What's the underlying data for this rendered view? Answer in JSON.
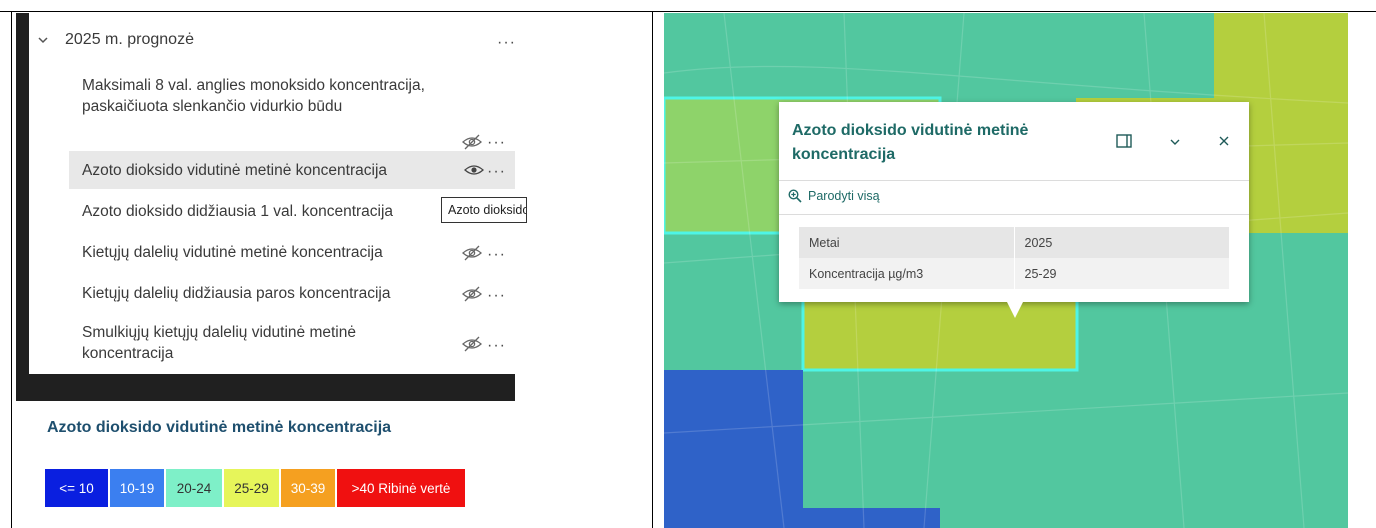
{
  "layer_panel": {
    "group_label": "2025 m. prognozė",
    "layers": [
      {
        "label": "Maksimali 8 val. anglies monoksido koncentracija, paskaičiuota slenkančio vidurkio būdu",
        "visible": false
      },
      {
        "label": "Azoto dioksido vidutinė metinė koncentracija",
        "visible": true,
        "selected": true
      },
      {
        "label": "Azoto dioksido didžiausia 1 val. koncentracija",
        "visible": false
      },
      {
        "label": "Kietųjų dalelių vidutinė metinė koncentracija",
        "visible": false
      },
      {
        "label": "Kietųjų dalelių didžiausia paros koncentracija",
        "visible": false
      },
      {
        "label": "Smulkiųjų kietųjų dalelių vidutinė metinė koncentracija",
        "visible": false
      }
    ],
    "tooltip": "Azoto dioksido vidutinė metinė koncentracija",
    "more_glyph": "···"
  },
  "legend": {
    "title": "Azoto dioksido vidutinė metinė koncentracija",
    "items": [
      {
        "label": "<= 10",
        "color": "#0a1fe0",
        "text_color": "#ffffff"
      },
      {
        "label": "10-19",
        "color": "#3b7ff0",
        "text_color": "#ffffff"
      },
      {
        "label": "20-24",
        "color": "#7ef0c8",
        "text_color": "#333333"
      },
      {
        "label": "25-29",
        "color": "#e6f55a",
        "text_color": "#333333"
      },
      {
        "label": "30-39",
        "color": "#f5a020",
        "text_color": "#ffffff"
      },
      {
        "label": ">40 Ribinė vertė",
        "color": "#f01010",
        "text_color": "#ffffff"
      }
    ]
  },
  "popup": {
    "title": "Azoto dioksido vidutinė metinė koncentracija",
    "zoom_label": "Parodyti visą",
    "rows": [
      {
        "key": "Metai",
        "value": "2025"
      },
      {
        "key": "Koncentracija µg/m3",
        "value": "25-29"
      }
    ]
  },
  "map_colors": {
    "teal": "#52c79f",
    "green": "#8ed36a",
    "yellow_green": "#b4cf3e",
    "blue": "#2f62c8",
    "highlight": "#4ef5e6"
  }
}
